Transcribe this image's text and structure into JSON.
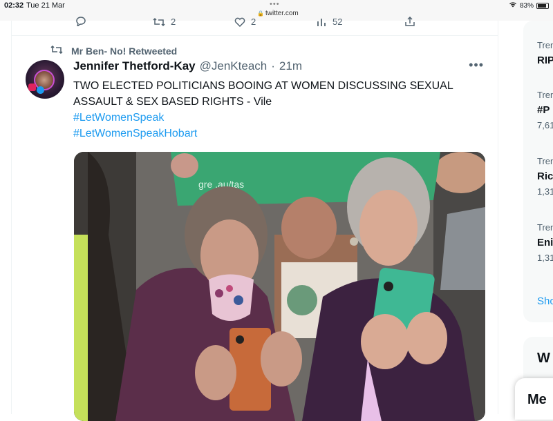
{
  "status_bar": {
    "time": "02:32",
    "date": "Tue 21 Mar",
    "url": "twitter.com",
    "battery_percent": "83%",
    "battery_level": 0.83
  },
  "action_row": {
    "reply_icon": "reply-icon",
    "retweet_icon": "retweet-icon",
    "retweet_count": "2",
    "like_icon": "heart-icon",
    "like_count": "2",
    "views_icon": "analytics-icon",
    "views_count": "52",
    "share_icon": "share-icon"
  },
  "tweet": {
    "retweeted_by": "Mr Ben- No! Retweeted",
    "author_name": "Jennifer Thetford-Kay",
    "author_handle": "@JenKteach",
    "separator": "·",
    "time": "21m",
    "more_label": "•••",
    "text": "TWO ELECTED POLITICIANS BOOING AT WOMEN DISCUSSING SEXUAL ASSAULT & SEX BASED RIGHTS - Vile",
    "hashtags": [
      "#LetWomenSpeak",
      "#LetWomenSpeakHobart"
    ],
    "banner_text": "gre        .au/tas"
  },
  "sidebar": {
    "trends": [
      {
        "category": "Tren",
        "name": "RIP",
        "count": ""
      },
      {
        "category": "Tren",
        "name": "#P",
        "count": "7,61"
      },
      {
        "category": "Tren",
        "name": "Ric",
        "count": "1,31"
      },
      {
        "category": "Tren",
        "name": "Eni",
        "count": "1,31"
      }
    ],
    "show_more": "Sho",
    "who_to_follow_title": "W",
    "messages_label": "Me"
  },
  "colors": {
    "accent": "#1d9bf0",
    "muted": "#536471",
    "text": "#0f1419"
  }
}
